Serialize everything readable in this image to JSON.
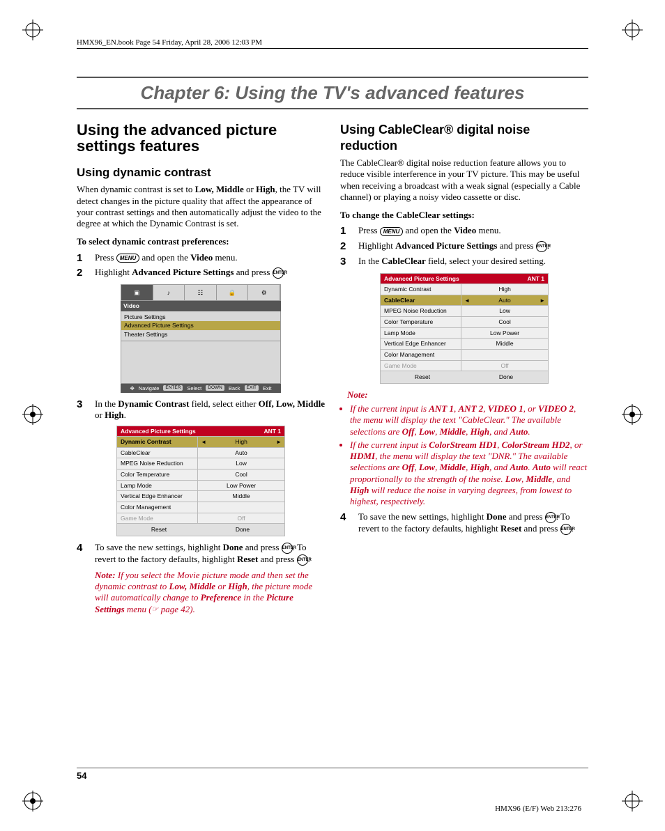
{
  "header": "HMX96_EN.book  Page 54  Friday, April 28, 2006  12:03 PM",
  "chapter_title": "Chapter 6: Using the TV's advanced features",
  "left": {
    "h1": "Using the advanced picture settings features",
    "h2a": "Using dynamic contrast",
    "intro_a": "When dynamic contrast is set to ",
    "intro_b": "Low, Middle",
    "intro_c": " or ",
    "intro_d": "High",
    "intro_e": ", the TV will detect changes in the picture quality that affect the appearance of your contrast settings and then automatically adjust the video to the degree at which the Dynamic Contrast is set.",
    "task": "To select dynamic contrast preferences:",
    "s1a": "Press ",
    "s1b": " and open the ",
    "s1c": "Video",
    "s1d": " menu.",
    "s2a": "Highlight ",
    "s2b": "Advanced Picture Settings",
    "s2c": " and press ",
    "s3a": "In the ",
    "s3b": "Dynamic Contrast",
    "s3c": " field, select either ",
    "s3d": "Off, Low, Middle",
    "s3e": " or ",
    "s3f": "High",
    "s3g": ".",
    "s4a": "To save the new settings, highlight ",
    "s4b": "Done",
    "s4c": " and press ",
    "s4d": ". To revert to the factory defaults, highlight ",
    "s4e": "Reset",
    "s4f": " and press ",
    "note_label": "Note:",
    "note_a": " If you select the Movie picture mode and then set the dynamic contrast to ",
    "note_b": "Low, Middle",
    "note_c": " or ",
    "note_d": "High",
    "note_e": ", the picture mode will automatically change to ",
    "note_f": "Preference",
    "note_g": " in the ",
    "note_h": "Picture Settings",
    "note_i": " menu (",
    "note_j": " page 42).",
    "osd": {
      "label": "Video",
      "items": [
        "Picture Settings",
        "Advanced Picture Settings",
        "Theater Settings"
      ],
      "footer": {
        "nav": "Navigate",
        "sel": "Select",
        "selK": "ENTER",
        "back": "Back",
        "backK": "DOWN",
        "exit": "Exit",
        "exitK": "EXIT"
      }
    },
    "table": {
      "title": "Advanced Picture Settings",
      "tag": "ANT 1",
      "rows": [
        {
          "k": "Dynamic Contrast",
          "v": "High",
          "hl": true,
          "arrows": true
        },
        {
          "k": "CableClear",
          "v": "Auto"
        },
        {
          "k": "MPEG Noise Reduction",
          "v": "Low"
        },
        {
          "k": "Color Temperature",
          "v": "Cool"
        },
        {
          "k": "Lamp Mode",
          "v": "Low Power"
        },
        {
          "k": "Vertical Edge Enhancer",
          "v": "Middle"
        },
        {
          "k": "Color Management",
          "v": ""
        },
        {
          "k": "Game Mode",
          "v": "Off",
          "dim": true
        }
      ],
      "reset": "Reset",
      "done": "Done"
    }
  },
  "right": {
    "h2": "Using CableClear® digital noise reduction",
    "intro": "The CableClear® digital noise reduction feature allows you to reduce visible interference in your TV picture. This may be useful when receiving a broadcast with a weak signal (especially a Cable channel) or playing a noisy video cassette or disc.",
    "task": "To change the CableClear settings:",
    "s1a": "Press ",
    "s1b": " and open the ",
    "s1c": "Video",
    "s1d": " menu.",
    "s2a": "Highlight ",
    "s2b": "Advanced Picture Settings",
    "s2c": " and press ",
    "s3a": "In the ",
    "s3b": "CableClear",
    "s3c": " field, select your desired setting.",
    "note_label": "Note:",
    "n1a": "If the current input is ",
    "n1b": "ANT 1",
    "n1c": ", ",
    "n1d": "ANT 2",
    "n1e": ", ",
    "n1f": "VIDEO 1",
    "n1g": ", or ",
    "n1h": "VIDEO 2",
    "n1i": ", the menu will display the text \"CableClear.\" The available selections are ",
    "n1j": "Off",
    "n1k": ", ",
    "n1l": "Low",
    "n1m": ", ",
    "n1n": "Middle",
    "n1o": ", ",
    "n1p": "High",
    "n1q": ", and ",
    "n1r": "Auto",
    "n1s": ".",
    "n2a": "If the current input is ",
    "n2b": "ColorStream HD1",
    "n2c": ", ",
    "n2d": "ColorStream HD2",
    "n2e": ", or ",
    "n2f": "HDMI",
    "n2g": ", the menu will display the text \"DNR.\" The available selections are ",
    "n2h": "Off",
    "n2i": ", ",
    "n2j": "Low",
    "n2k": ", ",
    "n2l": "Middle",
    "n2m": ", ",
    "n2n": "High",
    "n2o": ", and ",
    "n2p": "Auto",
    "n2q": ". ",
    "n2r": "Auto",
    "n2s": " will react proportionally to the strength of the noise. ",
    "n2t": "Low",
    "n2u": ", ",
    "n2v": "Middle",
    "n2w": ", and ",
    "n2x": "High",
    "n2y": " will reduce the noise in varying degrees, from lowest to highest, respectively.",
    "s4a": "To save the new settings, highlight ",
    "s4b": "Done",
    "s4c": " and press ",
    "s4d": ". To revert to the factory defaults, highlight ",
    "s4e": "Reset",
    "s4f": " and press ",
    "table": {
      "title": "Advanced Picture Settings",
      "tag": "ANT 1",
      "rows": [
        {
          "k": "Dynamic Contrast",
          "v": "High"
        },
        {
          "k": "CableClear",
          "v": "Auto",
          "hl": true,
          "arrows": true
        },
        {
          "k": "MPEG Noise Reduction",
          "v": "Low"
        },
        {
          "k": "Color Temperature",
          "v": "Cool"
        },
        {
          "k": "Lamp Mode",
          "v": "Low Power"
        },
        {
          "k": "Vertical Edge Enhancer",
          "v": "Middle"
        },
        {
          "k": "Color Management",
          "v": ""
        },
        {
          "k": "Game Mode",
          "v": "Off",
          "dim": true
        }
      ],
      "reset": "Reset",
      "done": "Done"
    }
  },
  "key_menu": "MENU",
  "key_enter": "ENTER",
  "page_number": "54",
  "footer_right": "HMX96 (E/F) Web 213:276"
}
